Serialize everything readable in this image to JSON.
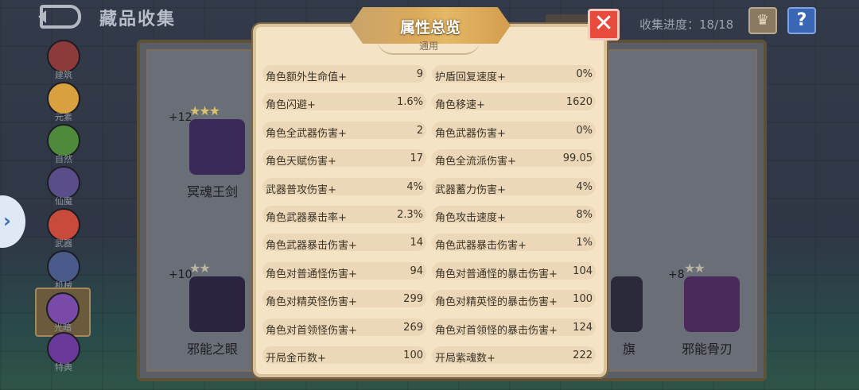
{
  "header": {
    "title": "藏品收集",
    "progress": "收集进度：18/18",
    "back_icon": "back-arrow-icon",
    "crown_icon": "crown-icon",
    "help_label": "?"
  },
  "sidebar": {
    "items": [
      {
        "label": "建筑",
        "color": "#8c3a3a"
      },
      {
        "label": "元素",
        "color": "#d9a040"
      },
      {
        "label": "自然",
        "color": "#4e8a3c"
      },
      {
        "label": "仙魔",
        "color": "#5a4e8a"
      },
      {
        "label": "武器",
        "color": "#c84a3a"
      },
      {
        "label": "机械",
        "color": "#4a5a8a"
      },
      {
        "label": "光暗",
        "color": "#7a4aa8"
      },
      {
        "label": "特典",
        "color": "#6a3a9a"
      }
    ],
    "expand_icon": "›"
  },
  "collection": {
    "items": [
      {
        "name": "冥魂王剑",
        "level": "+12",
        "stars": "★★★",
        "color": "#3a2a5a"
      },
      {
        "name": "邪能之眼",
        "level": "+10",
        "stars": "★★",
        "color": "#2a2440"
      },
      {
        "name": "旗",
        "level": "",
        "stars": "",
        "color": "#2a2a3a"
      },
      {
        "name": "邪能骨刃",
        "level": "+8",
        "stars": "★★",
        "color": "#4a2a5a"
      }
    ]
  },
  "dialog": {
    "title": "属性总览",
    "subtab": "通用",
    "close_icon": "close-icon",
    "stats": [
      {
        "name": "角色额外生命值+",
        "value": "9"
      },
      {
        "name": "护盾回复速度+",
        "value": "0%"
      },
      {
        "name": "角色闪避+",
        "value": "1.6%"
      },
      {
        "name": "角色移速+",
        "value": "1620"
      },
      {
        "name": "角色全武器伤害+",
        "value": "2"
      },
      {
        "name": "角色武器伤害+",
        "value": "0%"
      },
      {
        "name": "角色天赋伤害+",
        "value": "17"
      },
      {
        "name": "角色全流派伤害+",
        "value": "99.05"
      },
      {
        "name": "武器普攻伤害+",
        "value": "4%"
      },
      {
        "name": "武器蓄力伤害+",
        "value": "4%"
      },
      {
        "name": "角色武器暴击率+",
        "value": "2.3%"
      },
      {
        "name": "角色攻击速度+",
        "value": "8%"
      },
      {
        "name": "角色武器暴击伤害+",
        "value": "14"
      },
      {
        "name": "角色武器暴击伤害+",
        "value": "1%"
      },
      {
        "name": "角色对普通怪伤害+",
        "value": "94"
      },
      {
        "name": "角色对普通怪的暴击伤害+",
        "value": "104"
      },
      {
        "name": "角色对精英怪伤害+",
        "value": "299"
      },
      {
        "name": "角色对精英怪的暴击伤害+",
        "value": "100"
      },
      {
        "name": "角色对首领怪伤害+",
        "value": "269"
      },
      {
        "name": "角色对首领怪的暴击伤害+",
        "value": "124"
      },
      {
        "name": "开局金币数+",
        "value": "100"
      },
      {
        "name": "开局紫魂数+",
        "value": "222"
      }
    ]
  }
}
